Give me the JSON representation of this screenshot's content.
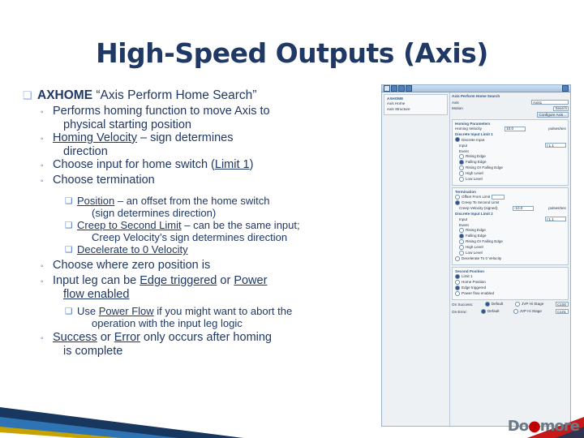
{
  "slide": {
    "title": "High-Speed Outputs (Axis)"
  },
  "content": {
    "lvl1": {
      "keyword": "AXHOME",
      "quoted": "“Axis Perform Home Search”"
    },
    "items": [
      {
        "level": 2,
        "text": "Performs homing function to move Axis to physical starting position"
      },
      {
        "level": 2,
        "text": "Homing Velocity – sign determines direction",
        "underline": "Homing Velocity"
      },
      {
        "level": 2,
        "text": "Choose input for home switch (Limit 1)",
        "underline": "Limit 1"
      },
      {
        "level": 2,
        "text": "Choose termination"
      },
      {
        "level": 3,
        "text": "Position – an offset from the home switch (sign determines direction)",
        "underline": "Position"
      },
      {
        "level": 3,
        "text": "Creep to Second Limit – can be the same input; Creep Velocity’s sign determines direction",
        "underline": "Creep to Second Limit"
      },
      {
        "level": 3,
        "text": "Decelerate to 0 Velocity",
        "underline": "Decelerate to 0 Velocity"
      },
      {
        "level": 2,
        "text": "Choose where zero position is"
      },
      {
        "level": 2,
        "text": "Input leg can be Edge triggered or Power flow enabled",
        "underline": "Edge triggered / Power flow enabled"
      },
      {
        "level": 3,
        "text": "Use Power Flow if you might want to abort the operation with the input leg logic",
        "underline": "Power Flow"
      },
      {
        "level": 2,
        "text": "Success or Error only occurs after homing is complete",
        "underline": "Success / Error"
      }
    ]
  },
  "dialog": {
    "titlebar": "",
    "left_tree": {
      "heading": "AXHOME",
      "items": [
        "Axis Home",
        "Axis Structure"
      ]
    },
    "right_header": {
      "title": "Axis Perform Home Search",
      "field1_label": "Axis",
      "field1_value": "Axis1",
      "field2_label": "Motion",
      "field2_value": "Search",
      "config_button": "Configure Axis..."
    },
    "sections": [
      {
        "name": "Homing Parameters",
        "rows": [
          {
            "label": "Homing Velocity",
            "value": "10.0",
            "unit": "pulses/sec"
          },
          {
            "label": "Discrete Input Limit 1",
            "value": ""
          },
          {
            "label": "Input",
            "value": "I:1.1"
          }
        ],
        "options": [
          "Discrete Input",
          "Event"
        ],
        "events": [
          "Rising Edge",
          "Falling Edge",
          "Rising Or Falling Edge",
          "High Level",
          "Low Level"
        ]
      },
      {
        "name": "Termination",
        "options": [
          "Offset From Limit",
          "Creep To Second Limit",
          "Decelerate To 0 Velocity"
        ],
        "rows": [
          {
            "label": "Creep Velocity (signed)",
            "value": "-10.0",
            "unit": "pulses/sec"
          },
          {
            "label": "Discrete Input Limit 2",
            "value": "I:1.1"
          }
        ],
        "events": [
          "Rising Edge",
          "Falling Edge",
          "Rising Or Falling Edge",
          "High Level",
          "Low Level"
        ]
      },
      {
        "name": "Second Position",
        "options": [
          "Limit 1",
          "Home Position"
        ],
        "extra_options": [
          "Edge triggered",
          "Power flow enabled"
        ]
      }
    ],
    "footer": {
      "on_success_label": "On Success:",
      "on_success_options": [
        "Default",
        "JVP Hi Stage"
      ],
      "on_success_value": "C100",
      "on_error_label": "On Error:",
      "on_error_options": [
        "Default",
        "JVP Hi Stage"
      ],
      "on_error_value": "C101"
    }
  },
  "branding": {
    "logo_text": "Do",
    "logo_dot": "●",
    "logo_rest": "more"
  },
  "colors": {
    "title": "#1f3864",
    "body": "#1f3864",
    "bullet_l1": "#8ea9db",
    "accent_red": "#c00000",
    "deco_dark": "#17375e",
    "deco_gold": "#c8a300"
  }
}
